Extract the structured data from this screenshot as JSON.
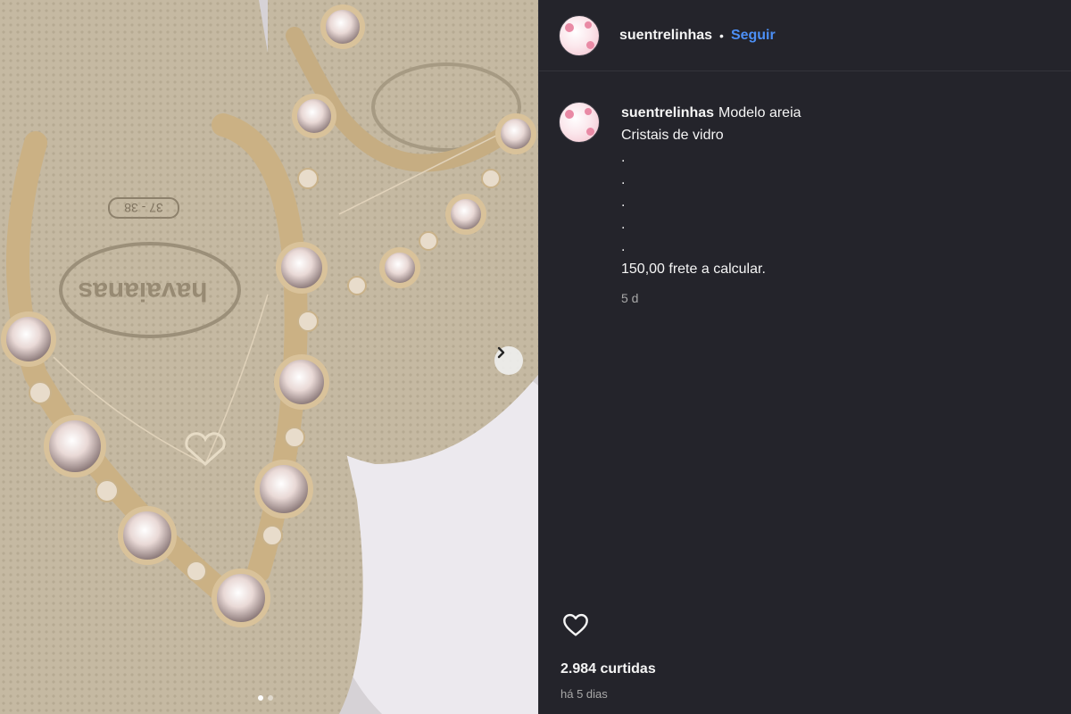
{
  "media": {
    "next_icon": "chevron-right-icon",
    "carousel_total": 2,
    "carousel_index": 1,
    "sole_brand_text": "havaianas",
    "sole_size_text": "37 - 38"
  },
  "post": {
    "username": "suentrelinhas",
    "separator": "•",
    "follow_label": "Seguir",
    "caption_lines": [
      "Modelo areia",
      "Cristais de vidro",
      ".",
      ".",
      ".",
      ".",
      ".",
      "150,00 frete a calcular."
    ],
    "relative_time": "5 d",
    "likes": "2.984 curtidas",
    "date": "há 5 dias",
    "like_icon": "heart-outline-icon"
  },
  "colors": {
    "panel_bg": "#24242b",
    "link": "#4c8ff5",
    "muted": "#a8a8a8"
  }
}
